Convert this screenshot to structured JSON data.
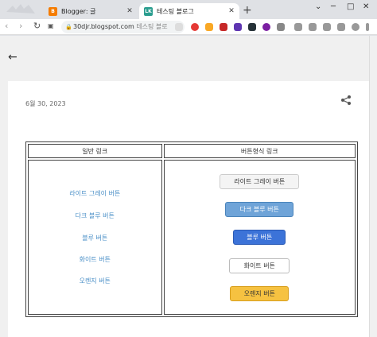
{
  "browser": {
    "tabs": [
      {
        "title": "Blogger: 글",
        "favicon": "blogger-icon",
        "favicon_color": "#f57c00",
        "active": false
      },
      {
        "title": "테스팅 블로그",
        "favicon": "lk-icon",
        "favicon_text": "LK",
        "favicon_color": "#2a9d8f",
        "active": true
      }
    ],
    "new_tab": "+",
    "window_controls": [
      "⌄",
      "─",
      "□",
      "✕"
    ],
    "address": {
      "host": "30djr.blogspot.com",
      "page_title": "테스팅 블로"
    }
  },
  "post": {
    "date": "6월 30, 2023",
    "table": {
      "headers": [
        "일반 링크",
        "버튼형식 링크"
      ],
      "links": [
        "라이트 그레이 버튼",
        "다크 블루 버튼",
        "블루 버튼",
        "화이트 버튼",
        "오렌지 버튼"
      ],
      "buttons": [
        "라이트 그레이 버튼",
        "다크 블루 버튼",
        "블루 버튼",
        "화이트 버튼",
        "오렌지 버튼"
      ]
    }
  },
  "colors": {
    "link": "#4a8fc7",
    "dark_blue": "#6fa4d8",
    "blue": "#3c73d8",
    "orange": "#f6c241"
  }
}
